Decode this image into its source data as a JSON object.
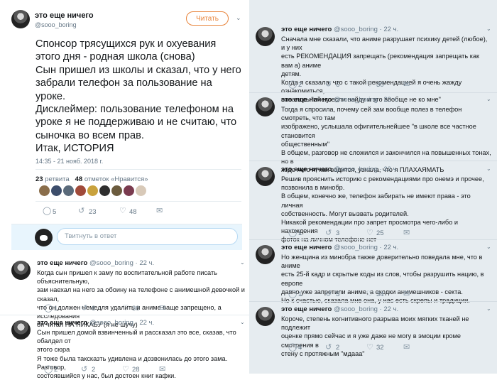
{
  "main_tweet": {
    "name": "это еще ничего",
    "handle": "@sooo_boring",
    "follow_label": "Читать",
    "paragraphs": [
      "Спонсор трясущихся рук и охуевания этого дня - родная школа (снова)",
      "Сын пришел из школы и сказал, что у него забрали телефон за пользование на уроке.",
      "Дисклеймер: пользование телефоном на уроке я не поддерживаю и не считаю, что сыночка во всем прав.",
      "Итак, ИСТОРИЯ"
    ],
    "timestamp": "14:35 - 21 нояб. 2018 г.",
    "retweets_count": "23",
    "retweets_label": "ретвита",
    "likes_count": "48",
    "likes_label": "отметок «Нравится»",
    "actions": {
      "replies": "5",
      "retweets": "23",
      "likes": "48"
    },
    "reply_placeholder": "Твитнуть в ответ"
  },
  "replies_left": [
    {
      "name": "это еще ничего",
      "handle": "@sooo_boring · 22 ч.",
      "lines": [
        "Когда сын пришел к заму по воспитательной работе писать объяснительную,",
        "зам наехал на него за обоину на телефоне с анимешной девочкой и сказал,",
        "что он должен немедля удалить и аниме ваще запрещено, а исследования",
        "он читал НА ПИКАБУ (я не шучу)"
      ],
      "actions": {
        "replies": "1",
        "retweets": "6",
        "likes": "30"
      }
    },
    {
      "name": "это еще ничего",
      "handle": "@sooo_boring · 22 ч.",
      "lines": [
        "Сын пришел домой взвинченный и рассказал это все, сказав, что обалдел от",
        "этого сюра",
        "Я тоже была таксказть удивлена и дозвонилась до этого зама. Разговор,",
        "состоявшийся у нас, был достоен книг кафки."
      ],
      "actions": {
        "replies": "2",
        "retweets": "2",
        "likes": "28"
      }
    }
  ],
  "replies_right": [
    {
      "name": "это еще ничего",
      "handle": "@sooo_boring · 22 ч.",
      "lines": [
        "Сначала мне сказали, что аниме разрушает психику детей (любое), и у них",
        "есть РЕКОМЕНДАЦИЯ запрещать (рекомендация запрещать как вам а) аниме",
        "детям.",
        "Когда я сказала, что с такой рекомендацией я очень жажду ознакомиться,",
        "началось \"ой ну если найду и это вообще не ко мне\""
      ],
      "actions": {
        "replies": "2",
        "retweets": "6",
        "likes": "30"
      }
    },
    {
      "name": "это еще ничего",
      "handle": "@sooo_boring · 22 ч.",
      "lines": [
        "Тогда я спросила, почему сей зам вообще полез в телефон смотреть, что там",
        "изображено, услышала офигительнейшее \"в школе все частное становится",
        "общественным\"",
        "В общем, разговор не сложился и закончился на повышенных тонах, но в",
        "ходе него я, как водится, узнала, что я ПЛАХАЯМАТЬ"
      ],
      "actions": {
        "replies": "",
        "retweets": "",
        "likes": ""
      }
    },
    {
      "name": "это еще ничего",
      "handle": "@sooo_boring · 22 ч.",
      "lines": [
        "Решив прояснить историю с рекомендациями про онемэ и прочее,",
        "позвонила в минобр.",
        "В общем, конечно же, телефон забирать не имеют права - это личная",
        "собственность. Могут вызвать родителей.",
        "Никакой рекомендации про запрет просмотра чего-либо и нахождения",
        "фоток на личном телефоне нет"
      ],
      "actions": {
        "replies": "1",
        "retweets": "3",
        "likes": "25"
      }
    },
    {
      "name": "это еще ничего",
      "handle": "@sooo_boring · 22 ч.",
      "lines": [
        "Но женщина из минобра также доверительно поведала мне, что в аниме",
        "есть 25-й кадр и скрытые коды из слов, чтобы разрушить нацию, в европе",
        "давно уже запретили аниме, а сходки анимешников - секта.",
        "Но к счастью, сказала мне она, у нас есть скрепы и традиции."
      ],
      "actions": {
        "replies": "1",
        "retweets": "5",
        "likes": "34"
      }
    },
    {
      "name": "это еще ничего",
      "handle": "@sooo_boring · 22 ч.",
      "lines": [
        "Короче, степень когнитивного разрыва моих мягких тканей не подлежит",
        "оценке прямо сейчас и я уже даже не могу в эмоции кроме смотрения в",
        "стену с протяжным \"мдааа\""
      ],
      "actions": {
        "replies": "4",
        "retweets": "2",
        "likes": "32"
      }
    }
  ],
  "icons": {
    "reply": "reply-icon",
    "retweet": "retweet-icon",
    "like": "heart-icon",
    "dm": "envelope-icon",
    "menu": "chevron-down-icon"
  },
  "colors": {
    "follow_accent": "#e8833a",
    "reply_box": "#e8f5fd"
  }
}
